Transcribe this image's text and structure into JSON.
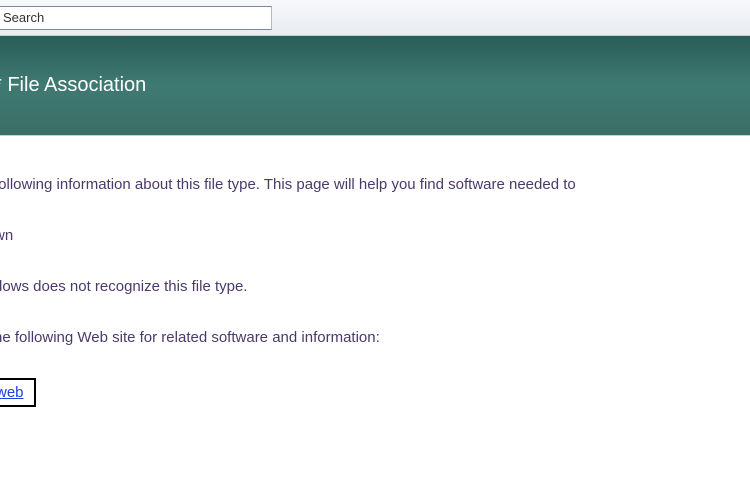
{
  "toolbar": {
    "search_label": "Search"
  },
  "banner": {
    "title": "* File Association"
  },
  "content": {
    "intro": "following information about this file type. This page will help you find software needed to",
    "line2": "wn",
    "line3": "dows does not recognize this file type.",
    "line4": "he following Web site for related software and information:",
    "link_label": "web"
  }
}
